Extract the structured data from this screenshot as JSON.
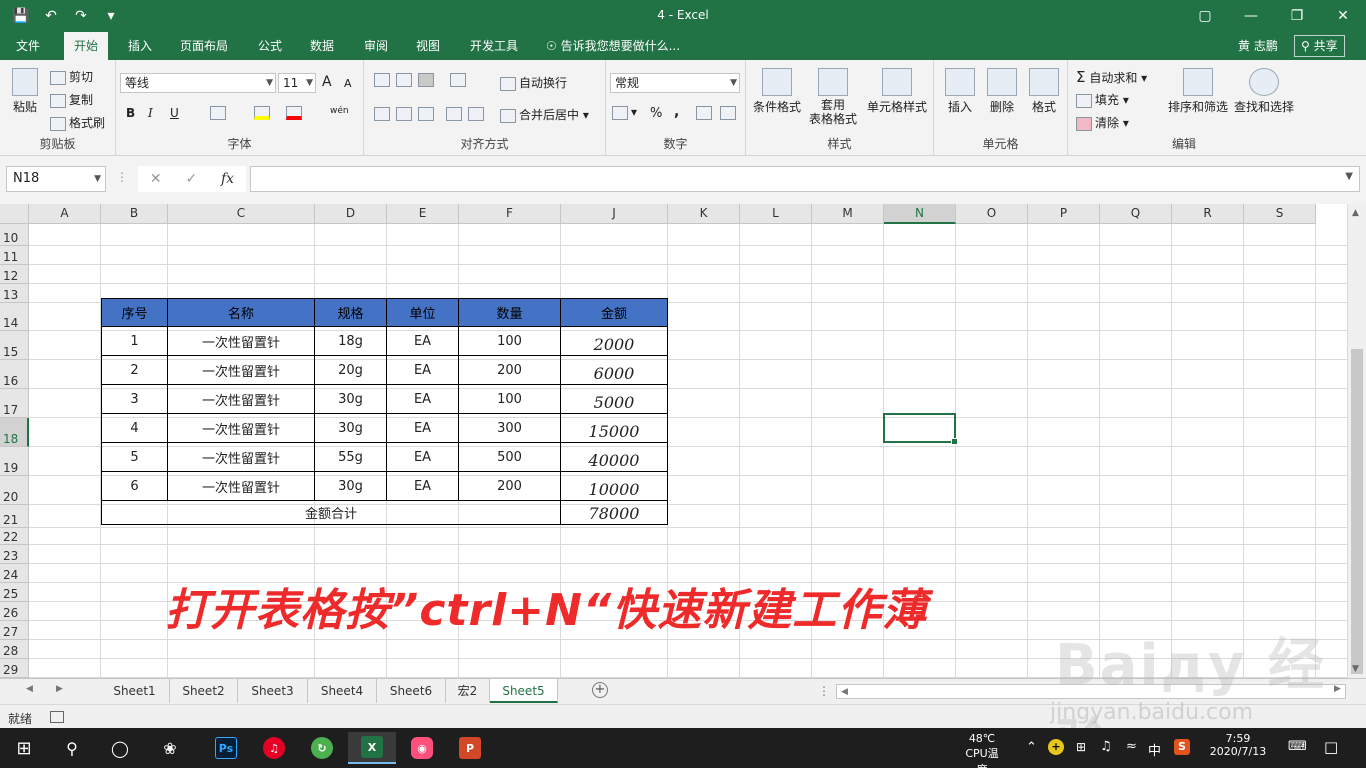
{
  "window": {
    "title": "4 - Excel",
    "controls": [
      "▢",
      "—",
      "❐",
      "✕"
    ]
  },
  "qat": {
    "save": "💾",
    "undo": "↶",
    "redo": "↷",
    "customize": "▾"
  },
  "menu": {
    "tabs": [
      "文件",
      "开始",
      "插入",
      "页面布局",
      "公式",
      "数据",
      "审阅",
      "视图",
      "开发工具"
    ],
    "active_index": 1,
    "tell_me": "告诉我您想要做什么...",
    "user": "黄 志鹏",
    "share": "共享"
  },
  "ribbon": {
    "clipboard": {
      "label": "剪贴板",
      "paste": "粘贴",
      "cut": "剪切",
      "copy": "复制",
      "format_painter": "格式刷"
    },
    "font": {
      "label": "字体",
      "font_name": "等线",
      "font_size": "11",
      "bold": "B",
      "italic": "I",
      "underline": "U",
      "grow": "A",
      "shrink": "A",
      "phonetic": "wén"
    },
    "alignment": {
      "label": "对齐方式",
      "wrap": "自动换行",
      "merge": "合并后居中"
    },
    "number": {
      "label": "数字",
      "format": "常规",
      "percent": "%",
      "comma": ","
    },
    "styles": {
      "label": "样式",
      "conditional": "条件格式",
      "table_format_1": "套用",
      "table_format_2": "表格格式",
      "cell_styles": "单元格样式"
    },
    "cells": {
      "label": "单元格",
      "insert": "插入",
      "delete": "删除",
      "format": "格式"
    },
    "editing": {
      "label": "编辑",
      "autosum": "自动求和",
      "fill": "填充",
      "clear": "清除",
      "sort_filter": "排序和筛选",
      "find_select": "查找和选择"
    }
  },
  "formula_bar": {
    "name_box": "N18",
    "cancel": "✕",
    "enter": "✓",
    "fx": "fx",
    "value": ""
  },
  "grid": {
    "columns": [
      "A",
      "B",
      "C",
      "D",
      "E",
      "F",
      "J",
      "K",
      "L",
      "M",
      "N",
      "O",
      "P",
      "Q",
      "R",
      "S"
    ],
    "selected_column": "N",
    "rows": [
      "10",
      "11",
      "12",
      "13",
      "14",
      "15",
      "16",
      "17",
      "18",
      "19",
      "20",
      "21",
      "22",
      "23",
      "24",
      "25",
      "26",
      "27",
      "28",
      "29"
    ],
    "selected_row": "18"
  },
  "table": {
    "headers": [
      "序号",
      "名称",
      "规格",
      "单位",
      "数量",
      "金额"
    ],
    "header_color": "#4472c4",
    "rows": [
      [
        "1",
        "一次性留置针",
        "18g",
        "EA",
        "100",
        "2000"
      ],
      [
        "2",
        "一次性留置针",
        "20g",
        "EA",
        "200",
        "6000"
      ],
      [
        "3",
        "一次性留置针",
        "30g",
        "EA",
        "100",
        "5000"
      ],
      [
        "4",
        "一次性留置针",
        "30g",
        "EA",
        "300",
        "15000"
      ],
      [
        "5",
        "一次性留置针",
        "55g",
        "EA",
        "500",
        "40000"
      ],
      [
        "6",
        "一次性留置针",
        "30g",
        "EA",
        "200",
        "10000"
      ]
    ],
    "total_label": "金额合计",
    "total_value": "78000"
  },
  "annotation": "打开表格按”ctrl+N“快速新建工作薄",
  "sheets": {
    "tabs": [
      "Sheet1",
      "Sheet2",
      "Sheet3",
      "Sheet4",
      "Sheet6",
      "宏2",
      "Sheet5"
    ],
    "active": "Sheet5"
  },
  "status": {
    "ready": "就绪"
  },
  "taskbar": {
    "temperature": "48℃",
    "cpu_label": "CPU温度",
    "ime": "中",
    "time": "7:59",
    "date": "2020/7/13",
    "apps": [
      "Ps",
      "X",
      "P"
    ]
  },
  "watermark": {
    "logo": "Baiду 经验",
    "url": "jingyan.baidu.com"
  }
}
